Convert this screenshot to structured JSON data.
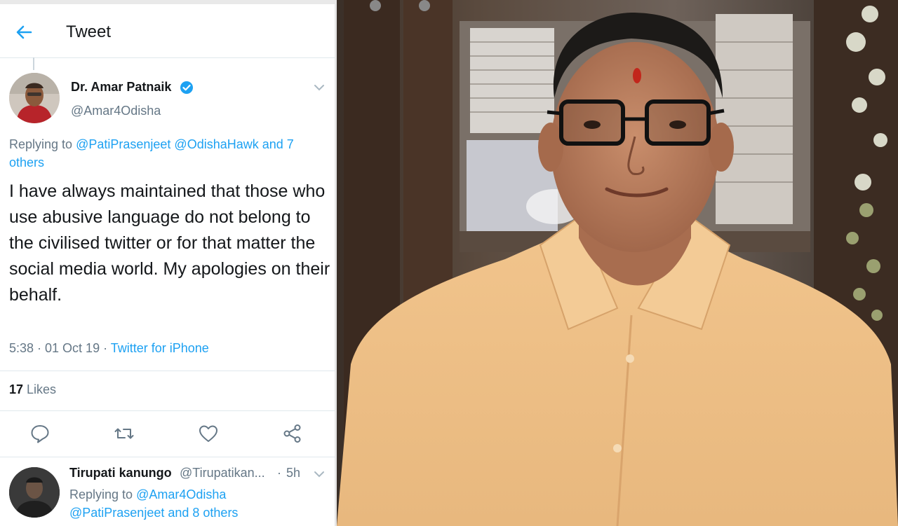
{
  "header": {
    "title": "Tweet",
    "back_icon": "arrow-left-icon"
  },
  "tweet": {
    "author_name": "Dr. Amar Patnaik",
    "author_handle": "@Amar4Odisha",
    "verified_icon": "verified-badge-icon",
    "replying_prefix": "Replying to ",
    "replying_mention_1": "@PatiPrasenjeet",
    "replying_mention_2": "@OdishaHawk",
    "replying_rest": "and 7 others",
    "text": "I have always maintained that those who use abusive language do not belong to the civilised twitter or for that matter the social media world. My apologies on their behalf.",
    "timestamp": "5:38 · 01 Oct 19 · ",
    "source": "Twitter for iPhone",
    "likes_count": "17",
    "likes_label": " Likes",
    "actions": [
      "reply-icon",
      "retweet-icon",
      "like-icon",
      "share-icon"
    ],
    "accent_color": "#1da1f2"
  },
  "reply": {
    "name": "Tirupati kanungo",
    "handle": "@Tirupatikan...",
    "separator": "·",
    "time": "5h",
    "replying_prefix": "Replying to ",
    "replying_mention_1": "@Amar4Odisha",
    "replying_mention_2": "@PatiPrasenjeet",
    "replying_rest": "and 8 others"
  }
}
